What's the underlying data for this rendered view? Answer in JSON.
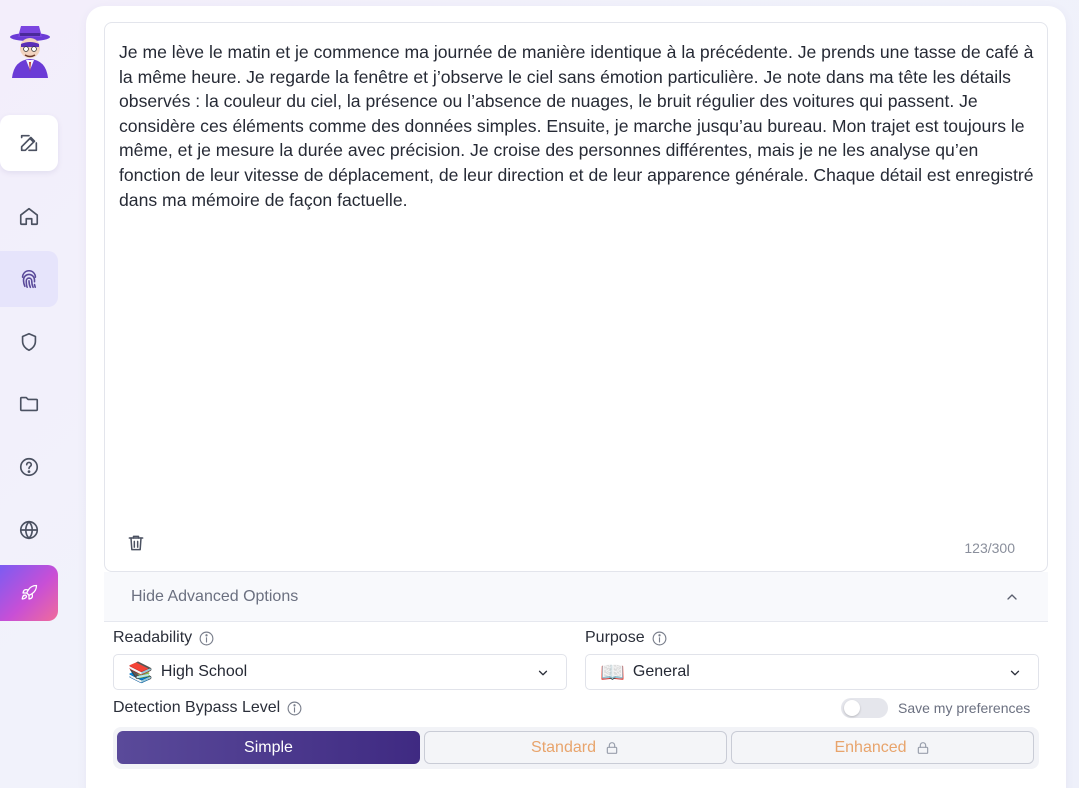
{
  "sidebar": {
    "logo_icon": "detective-avatar-icon",
    "items": [
      {
        "name": "edit",
        "icon": "edit-icon"
      },
      {
        "name": "home",
        "icon": "home-icon"
      },
      {
        "name": "fingerprint",
        "icon": "fingerprint-icon"
      },
      {
        "name": "shield",
        "icon": "shield-icon"
      },
      {
        "name": "folder",
        "icon": "folder-icon"
      },
      {
        "name": "help",
        "icon": "help-circle-icon"
      },
      {
        "name": "globe",
        "icon": "globe-icon"
      },
      {
        "name": "rocket",
        "icon": "rocket-icon"
      }
    ]
  },
  "editor": {
    "text": "Je me lève le matin et je commence ma journée de manière identique à la précédente. Je prends une tasse de café à la même heure. Je regarde la fenêtre et j’observe le ciel sans émotion particulière. Je note dans ma tête les détails observés : la couleur du ciel, la présence ou l’absence de nuages, le bruit régulier des voitures qui passent. Je considère ces éléments comme des données simples. Ensuite, je marche jusqu’au bureau. Mon trajet est toujours le même, et je mesure la durée avec précision. Je croise des personnes différentes, mais je ne les analyse qu’en fonction de leur vitesse de déplacement, de leur direction et de leur apparence générale. Chaque détail est enregistré dans ma mémoire de façon factuelle.",
    "counter": "123/300"
  },
  "advanced": {
    "toggle_label": "Hide Advanced Options",
    "readability_label": "Readability",
    "readability_emoji": "📚",
    "readability_value": "High School",
    "purpose_label": "Purpose",
    "purpose_emoji": "📖",
    "purpose_value": "General",
    "bypass_label": "Detection Bypass Level",
    "save_prefs_label": "Save my preferences",
    "save_prefs_on": false,
    "levels": [
      "Simple",
      "Standard",
      "Enhanced"
    ],
    "selected_level": "Simple"
  },
  "colors": {
    "accent": "#4a3690",
    "locked_text": "#e8a46c",
    "rocket_gradient_start": "#7b5cf2",
    "rocket_gradient_end": "#f06c9a"
  }
}
